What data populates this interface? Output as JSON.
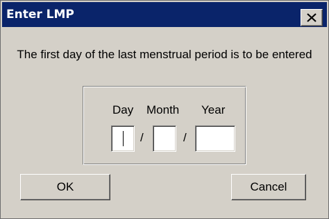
{
  "window": {
    "title": "Enter LMP",
    "close_icon": "close-x-icon"
  },
  "message": "The first day of the last menstrual period is to be entered",
  "date_entry": {
    "headers": {
      "day": "Day",
      "month": "Month",
      "year": "Year"
    },
    "separator": "/",
    "day_value": "",
    "month_value": "",
    "year_value": ""
  },
  "buttons": {
    "ok": "OK",
    "cancel": "Cancel"
  },
  "colors": {
    "title_bar": "#0a246a",
    "dialog_face": "#d4d0c8"
  }
}
